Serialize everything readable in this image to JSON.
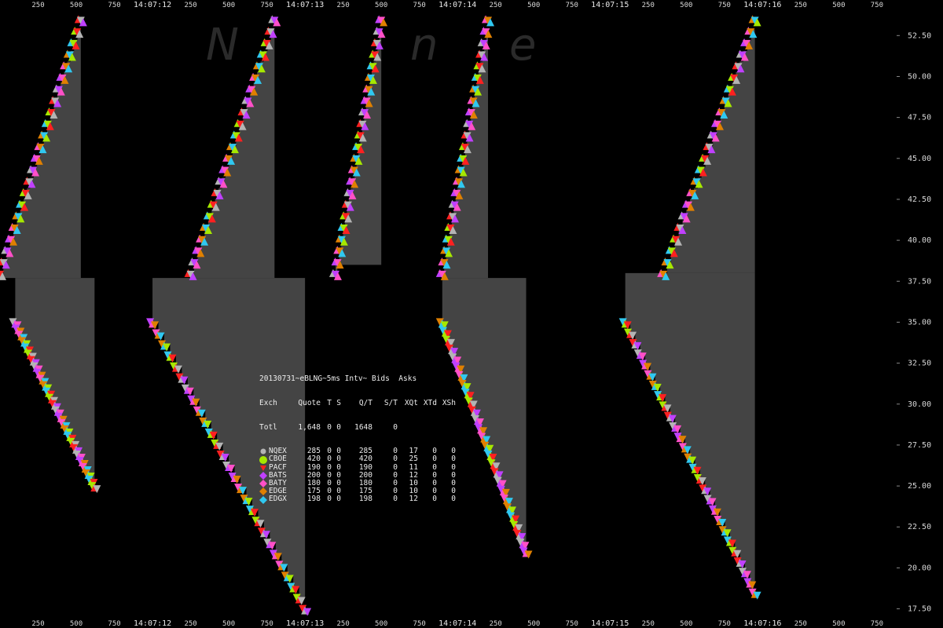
{
  "watermark": [
    "N",
    "n",
    "e"
  ],
  "x_axis": {
    "ms_ticks": [
      "250",
      "500",
      "750"
    ],
    "times": [
      "14:07:12",
      "14:07:13",
      "14:07:14",
      "14:07:15",
      "14:07:16"
    ]
  },
  "colors": {
    "background": "#000000",
    "range_fill": "#444444",
    "NQEX": "#b4b4b4",
    "CBOE": "#a6e800",
    "PACF": "#ff2020",
    "BATS": "#c040ff",
    "BATY": "#ff50c8",
    "EDGE": "#e08000",
    "EDGX": "#30c8f0"
  },
  "legend": {
    "title": "20130731~eBLNG~5ms Intv~ Bids  Asks",
    "header": [
      "Exch",
      "Quote",
      "T",
      "S",
      "Q/T",
      "S/T",
      "XQt",
      "XTd",
      "XSh"
    ],
    "total": {
      "label": "Totl",
      "quote": "1,648",
      "t": "0",
      "s": "0",
      "qt": "1648",
      "st": "0"
    },
    "rows": [
      {
        "exch": "NQEX",
        "quote": "285",
        "t": "0",
        "s": "0",
        "qt": "285",
        "st": "0",
        "xqt": "17",
        "xtd": "0",
        "xsh": "0",
        "marker": "circle"
      },
      {
        "exch": "CBOE",
        "quote": "420",
        "t": "0",
        "s": "0",
        "qt": "420",
        "st": "0",
        "xqt": "25",
        "xtd": "0",
        "xsh": "0",
        "marker": "circle"
      },
      {
        "exch": "PACF",
        "quote": "190",
        "t": "0",
        "s": "0",
        "qt": "190",
        "st": "0",
        "xqt": "11",
        "xtd": "0",
        "xsh": "0",
        "marker": "triangle-down"
      },
      {
        "exch": "BATS",
        "quote": "200",
        "t": "0",
        "s": "0",
        "qt": "200",
        "st": "0",
        "xqt": "12",
        "xtd": "0",
        "xsh": "0",
        "marker": "diamond"
      },
      {
        "exch": "BATY",
        "quote": "180",
        "t": "0",
        "s": "0",
        "qt": "180",
        "st": "0",
        "xqt": "10",
        "xtd": "0",
        "xsh": "0",
        "marker": "diamond"
      },
      {
        "exch": "EDGE",
        "quote": "175",
        "t": "0",
        "s": "0",
        "qt": "175",
        "st": "0",
        "xqt": "10",
        "xtd": "0",
        "xsh": "0",
        "marker": "diamond"
      },
      {
        "exch": "EDGX",
        "quote": "198",
        "t": "0",
        "s": "0",
        "qt": "198",
        "st": "0",
        "xqt": "12",
        "xtd": "0",
        "xsh": "0",
        "marker": "diamond"
      }
    ]
  },
  "chart_data": {
    "type": "scatter",
    "title": "",
    "xlabel": "",
    "ylabel": "",
    "x_unit": "seconds after 14:07:11",
    "xlim": [
      0.0,
      5.9
    ],
    "ylim": [
      17.0,
      54.0
    ],
    "y_ticks": [
      "17.50",
      "20.00",
      "22.50",
      "25.00",
      "27.50",
      "30.00",
      "32.50",
      "35.00",
      "37.50",
      "40.00",
      "42.50",
      "45.00",
      "47.50",
      "50.00",
      "52.50"
    ],
    "legend_position": "center",
    "cycles": [
      {
        "bid_start": [
          0.0,
          38.0
        ],
        "bid_end": [
          0.53,
          53.5
        ],
        "ask_start": [
          0.1,
          35.0
        ],
        "ask_end": [
          0.62,
          25.0
        ],
        "flat_bid": 37.7
      },
      {
        "bid_start": [
          1.25,
          38.0
        ],
        "bid_end": [
          1.8,
          53.5
        ],
        "ask_start": [
          1.0,
          35.0
        ],
        "ask_end": [
          2.0,
          17.5
        ],
        "flat_bid": 37.7
      },
      {
        "bid_start": [
          2.2,
          38.0
        ],
        "bid_end": [
          2.5,
          53.5
        ],
        "ask_start": null,
        "ask_end": null,
        "flat_bid": 38.5
      },
      {
        "bid_start": [
          2.9,
          38.0
        ],
        "bid_end": [
          3.2,
          53.5
        ],
        "ask_start": [
          2.9,
          35.0
        ],
        "ask_end": [
          3.45,
          21.0
        ],
        "flat_bid": 37.7
      },
      {
        "bid_start": [
          4.35,
          38.0
        ],
        "bid_end": [
          4.95,
          53.5
        ],
        "ask_start": [
          4.1,
          35.0
        ],
        "ask_end": [
          4.95,
          18.5
        ],
        "flat_bid": 38.0
      }
    ]
  }
}
